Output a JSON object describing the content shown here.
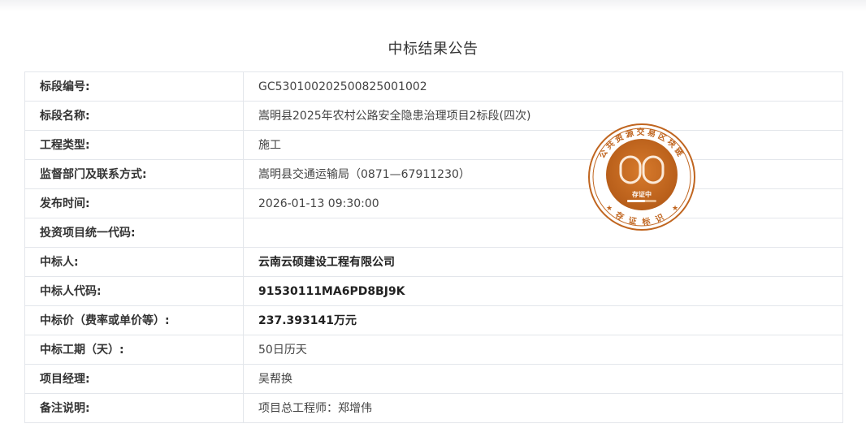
{
  "page": {
    "title": "中标结果公告"
  },
  "rows": [
    {
      "label": "标段编号:",
      "value": "GC5301002025008250010​02",
      "bold": false
    },
    {
      "label": "标段名称:",
      "value": "嵩明县2025年农村公路安全隐患治理项目2标段(四次)",
      "bold": false
    },
    {
      "label": "工程类型:",
      "value": "施工",
      "bold": false
    },
    {
      "label": "监督部门及联系方式:",
      "value": "嵩明县交通运输局（0871—67911230）",
      "bold": false
    },
    {
      "label": "发布时间:",
      "value": "2026-01-13 09:30:00",
      "bold": false
    },
    {
      "label": "投资项目统一代码:",
      "value": "",
      "bold": false
    },
    {
      "label": "中标人:",
      "value": "云南云硕建设工程有限公司",
      "bold": true
    },
    {
      "label": "中标人代码:",
      "value": "91530111MA6PD8BJ9K",
      "bold": true
    },
    {
      "label": "中标价（费率或单价等）:",
      "value": "237.393141万元",
      "bold": true
    },
    {
      "label": "中标工期（天）:",
      "value": "50日历天",
      "bold": false
    },
    {
      "label": "项目经理:",
      "value": "吴帮换",
      "bold": false
    },
    {
      "label": "备注说明:",
      "value": "项目总工程师：郑增伟",
      "bold": false
    }
  ],
  "stamp": {
    "ring_text": "公共资源交易区块链",
    "inner_text": "存证中",
    "bottom_text": "存证标识",
    "color": "#c0651f"
  }
}
